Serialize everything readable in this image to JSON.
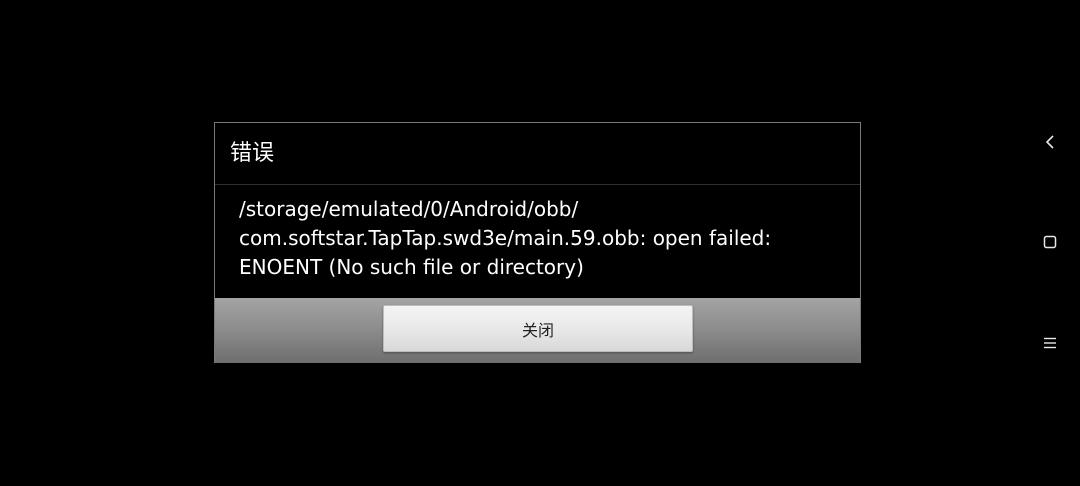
{
  "background_ghost": {
    "title": "错误"
  },
  "dialog": {
    "title": "错误",
    "message": "/storage/emulated/0/Android/obb/\ncom.softstar.TapTap.swd3e/main.59.obb: open failed:\nENOENT (No such file or directory)",
    "close_label": "关闭"
  },
  "navigation": {
    "back_icon": "back-icon",
    "home_icon": "home-icon",
    "menu_icon": "menu-icon"
  },
  "colors": {
    "background": "#000000",
    "dialog_border": "#7a7a7a",
    "text": "#ffffff",
    "footer": "#8e8e8e",
    "button": "#e6e6e6"
  }
}
